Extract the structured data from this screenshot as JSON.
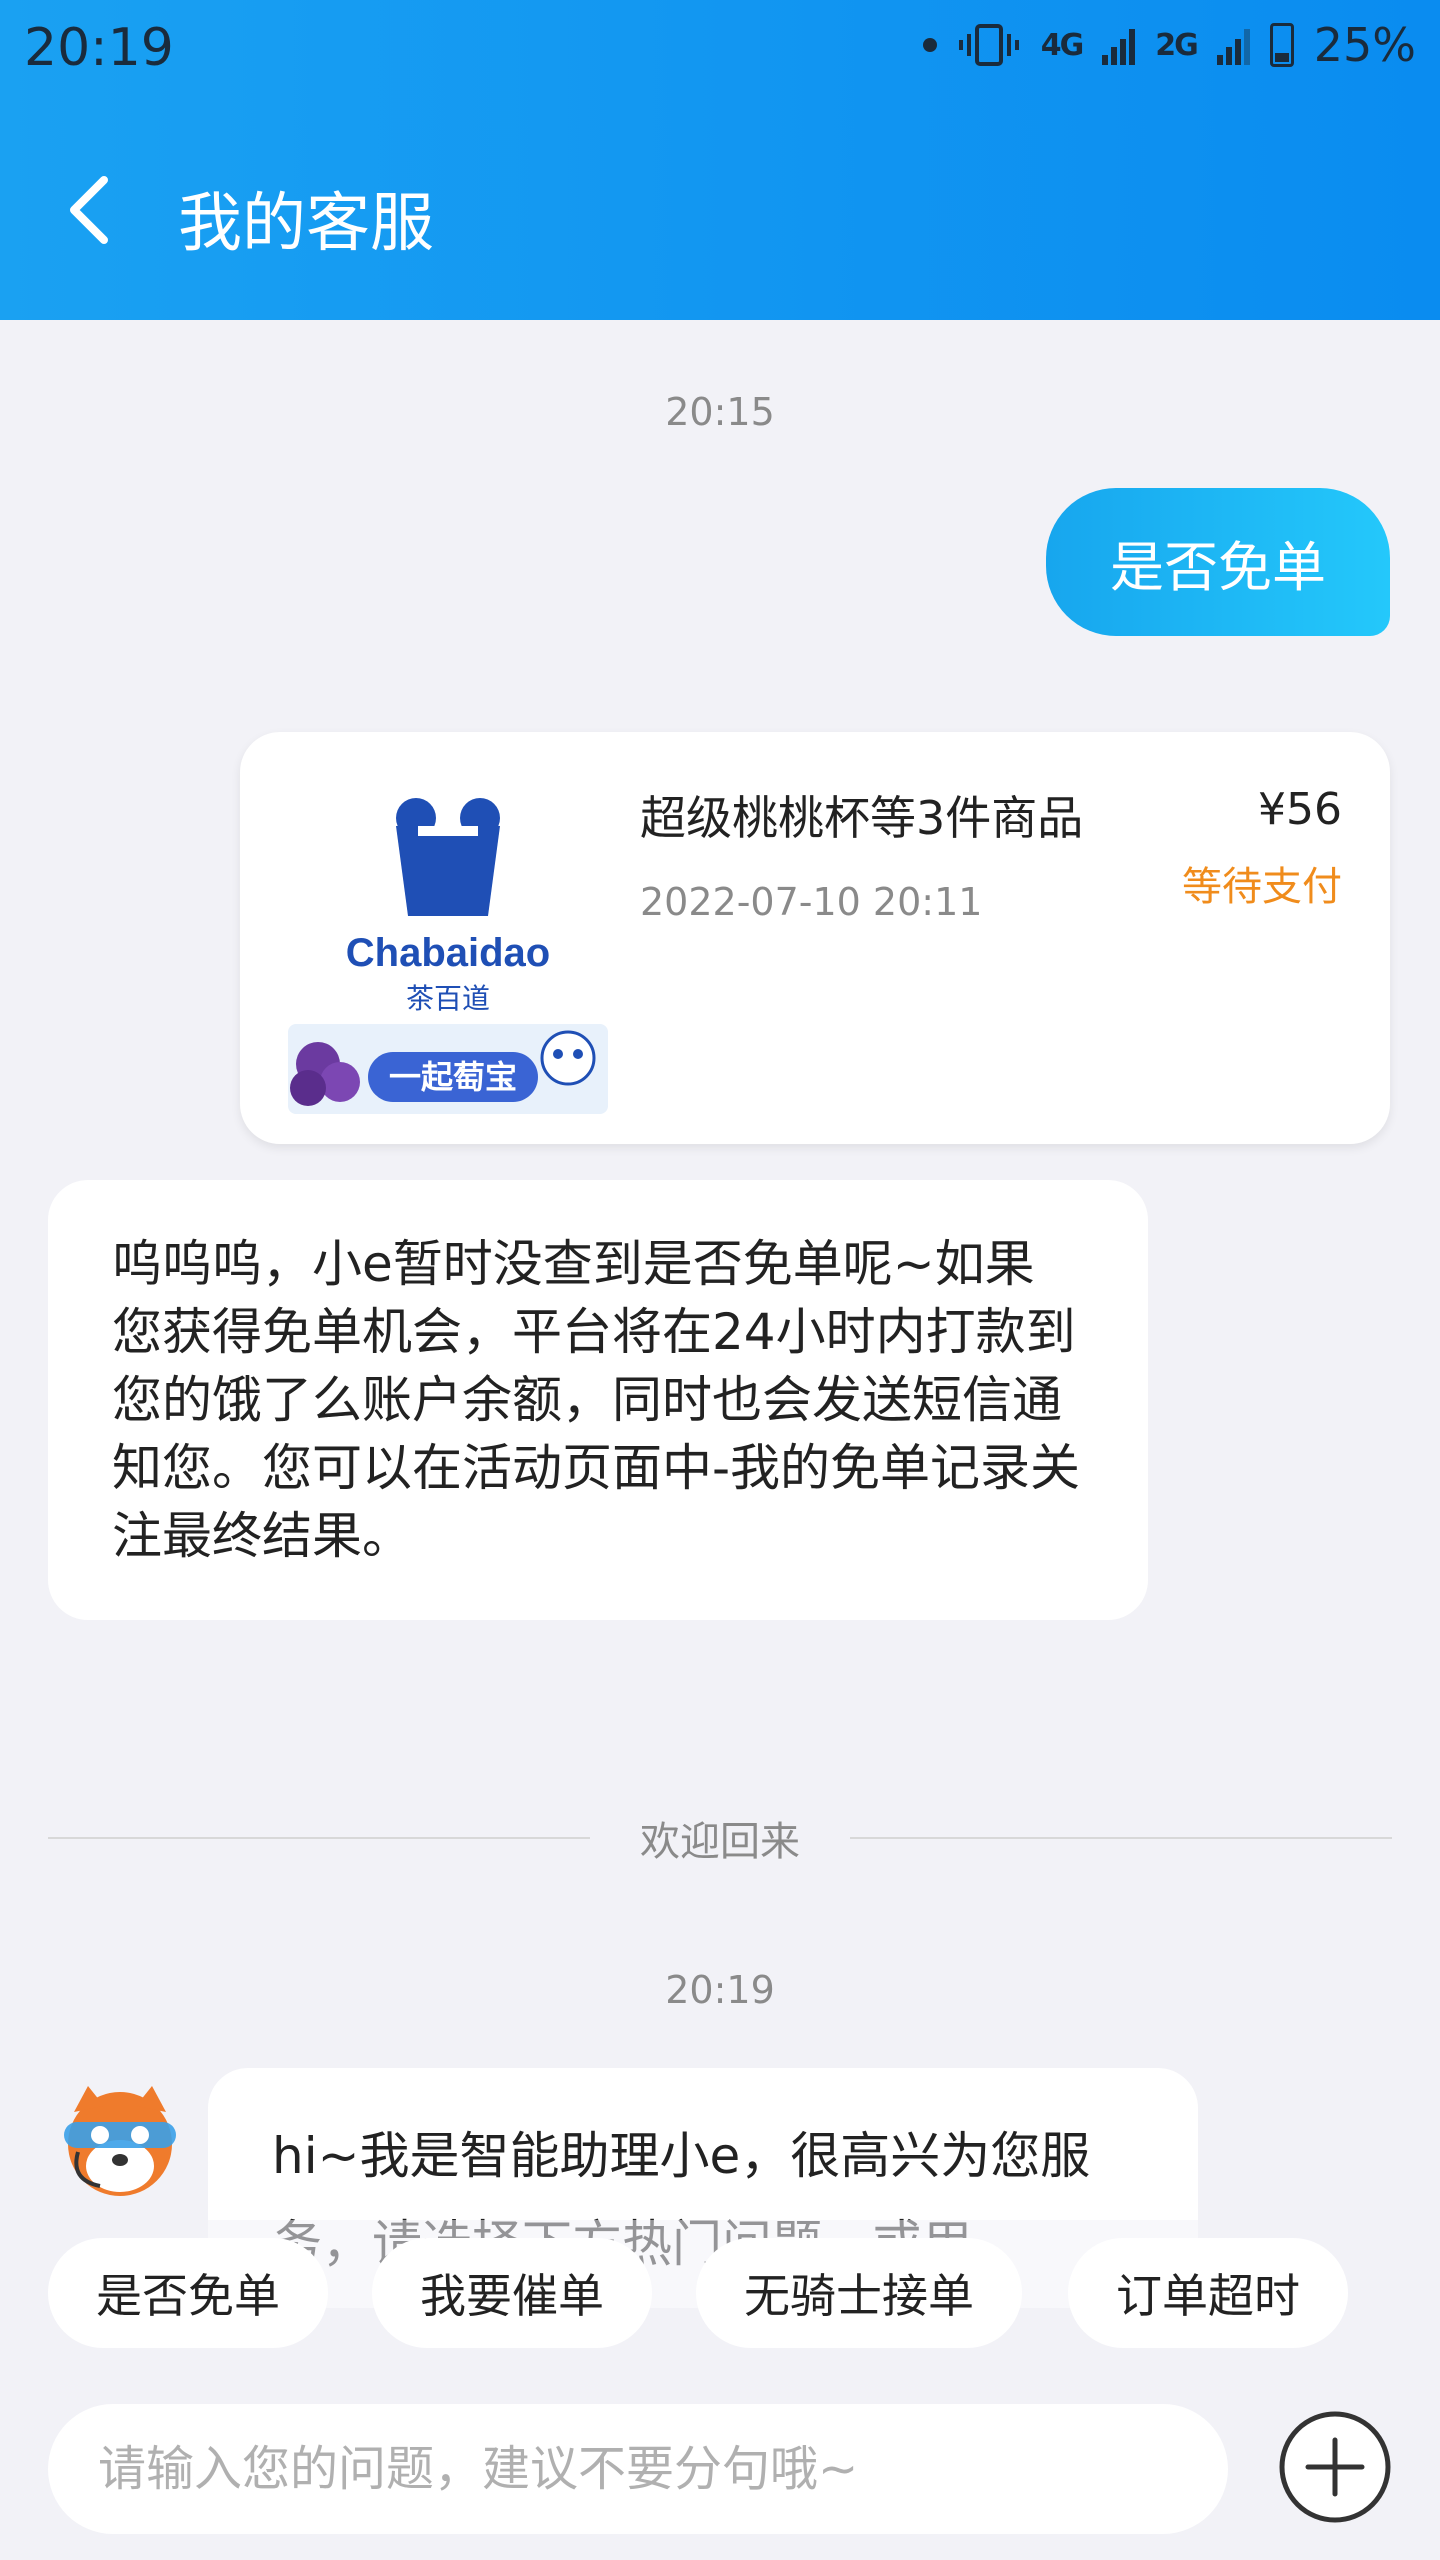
{
  "status_bar": {
    "time": "20:19",
    "network_1": "4G",
    "network_2": "2G",
    "battery": "25%"
  },
  "header": {
    "title": "我的客服",
    "back_icon": "chevron-left-icon"
  },
  "messages": {
    "time_1": "20:15",
    "user_message": "是否免单",
    "order_card": {
      "logo_brand": "Chabaidao",
      "logo_cn": "茶百道",
      "logo_banner": "一起萄宝",
      "item_name": "超级桃桃杯等3件商品",
      "order_time": "2022-07-10 20:11",
      "price": "¥56",
      "status": "等待支付"
    },
    "bot_reply": "呜呜呜，小e暂时没查到是否免单呢~如果您获得免单机会，平台将在24小时内打款到您的饿了么账户余额，同时也会发送短信通知您。您可以在活动页面中-我的免单记录关注最终结果。",
    "divider_label": "欢迎回来",
    "time_2": "20:19",
    "bot_greeting": "hi~我是智能助理小e，很高兴为您服务，请选择下方热门问题，或用"
  },
  "quick_replies": [
    "是否免单",
    "我要催单",
    "无骑士接单",
    "订单超时"
  ],
  "input": {
    "placeholder": "请输入您的问题，建议不要分句哦~"
  },
  "colors": {
    "header_gradient_start": "#1aa1f2",
    "header_gradient_end": "#0a8cf0",
    "user_bubble": "#17a6ee",
    "status_orange": "#f08c1c"
  }
}
